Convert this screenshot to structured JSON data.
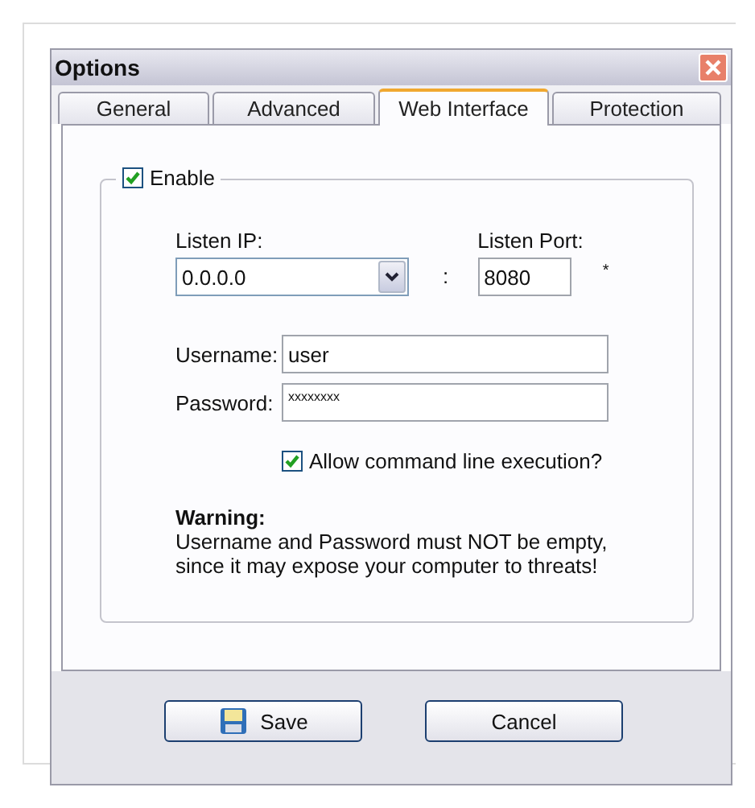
{
  "window": {
    "title": "Options"
  },
  "tabs": [
    {
      "label": "General",
      "selected": false
    },
    {
      "label": "Advanced",
      "selected": false
    },
    {
      "label": "Web Interface",
      "selected": true
    },
    {
      "label": "Protection",
      "selected": false
    }
  ],
  "enable": {
    "label": "Enable",
    "checked": true
  },
  "listen_ip": {
    "label": "Listen IP:",
    "value": "0.0.0.0"
  },
  "separator": ":",
  "listen_port": {
    "label": "Listen Port:",
    "value": "8080",
    "note": "*"
  },
  "username": {
    "label": "Username:",
    "value": "user"
  },
  "password": {
    "label": "Password:",
    "value": "xxxxxxxx"
  },
  "allow_cmd": {
    "label": "Allow command line execution?",
    "checked": true
  },
  "warning": {
    "title": "Warning:",
    "lines": [
      "Username and Password must NOT be empty,",
      "since it may expose your computer to threats!"
    ]
  },
  "buttons": [
    {
      "label": "Save",
      "kind": "save"
    },
    {
      "label": "Cancel",
      "kind": "plain"
    }
  ]
}
